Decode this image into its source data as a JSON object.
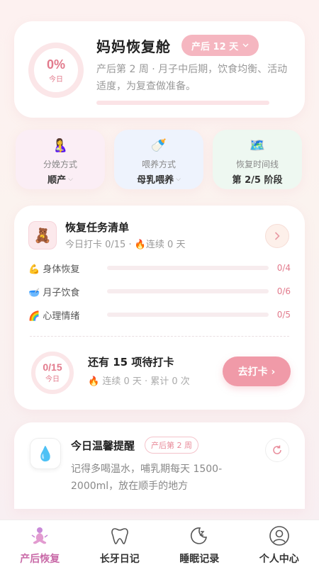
{
  "hero": {
    "percent": "0%",
    "percent_label": "今日",
    "title": "妈妈恢复舱",
    "badge": "产后 12 天",
    "description": "产后第 2 周 · 月子中后期，饮食均衡、活动适度，为复查做准备。",
    "progress": 0
  },
  "cards": {
    "delivery": {
      "icon": "mother-icon",
      "label": "分娩方式",
      "value": "顺产"
    },
    "feeding": {
      "icon": "baby-bottle-icon",
      "label": "喂养方式",
      "value": "母乳喂养"
    },
    "timeline": {
      "icon": "map-icon",
      "label": "恢复时间线",
      "value": "第 2/5 阶段"
    }
  },
  "tasks": {
    "title": "恢复任务清单",
    "subtitle_checkin": "今日打卡 0/15",
    "subtitle_streak": "连续 0 天",
    "rows": [
      {
        "emoji": "💪",
        "label": "身体恢复",
        "value": "0/4",
        "progress": 0
      },
      {
        "emoji": "🥣",
        "label": "月子饮食",
        "value": "0/6",
        "progress": 0
      },
      {
        "emoji": "🌈",
        "label": "心理情绪",
        "value": "0/5",
        "progress": 0
      }
    ],
    "ring_value": "0/15",
    "ring_label": "今日",
    "pending_text": "还有 15 项待打卡",
    "streak_text": "连续 0 天 · 累计 0 次",
    "button_label": "去打卡 ›"
  },
  "reminder": {
    "title": "今日温馨提醒",
    "tag": "产后第 2 周",
    "text": "记得多喝温水，哺乳期每天 1500-2000ml，放在顺手的地方"
  },
  "tabs": [
    {
      "label": "产后恢复",
      "icon": "mother-meditate-icon",
      "active": true
    },
    {
      "label": "长牙日记",
      "icon": "tooth-icon",
      "active": false
    },
    {
      "label": "睡眠记录",
      "icon": "moon-sleep-icon",
      "active": false
    },
    {
      "label": "个人中心",
      "icon": "user-icon",
      "active": false
    }
  ],
  "colors": {
    "accent": "#f09aa8",
    "accent_text": "#e27a8c",
    "active_tab": "#c96aa8"
  }
}
